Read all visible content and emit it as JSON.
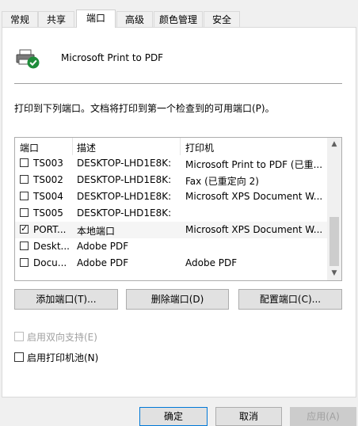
{
  "tabs": [
    {
      "label": "常规"
    },
    {
      "label": "共享"
    },
    {
      "label": "端口"
    },
    {
      "label": "高级"
    },
    {
      "label": "颜色管理"
    },
    {
      "label": "安全"
    }
  ],
  "active_tab": "端口",
  "printer_name": "Microsoft Print to PDF",
  "instruction": "打印到下列端口。文档将打印到第一个检查到的可用端口(P)。",
  "ports_list": {
    "headers": {
      "port": "端口",
      "description": "描述",
      "printer": "打印机"
    },
    "rows": [
      {
        "checked": false,
        "port": "TS003",
        "description": "DESKTOP-LHD1E8K:",
        "printer": "Microsoft Print to PDF (已重..."
      },
      {
        "checked": false,
        "port": "TS002",
        "description": "DESKTOP-LHD1E8K:",
        "printer": "Fax (已重定向 2)"
      },
      {
        "checked": false,
        "port": "TS004",
        "description": "DESKTOP-LHD1E8K:",
        "printer": "Microsoft XPS Document W..."
      },
      {
        "checked": false,
        "port": "TS005",
        "description": "DESKTOP-LHD1E8K:",
        "printer": ""
      },
      {
        "checked": true,
        "port": "PORT...",
        "description": "本地端口",
        "printer": "Microsoft XPS Document W..."
      },
      {
        "checked": false,
        "port": "Deskt...",
        "description": "Adobe PDF",
        "printer": ""
      },
      {
        "checked": false,
        "port": "Docu...",
        "description": "Adobe PDF",
        "printer": "Adobe PDF"
      }
    ]
  },
  "buttons": {
    "add_port": "添加端口(T)...",
    "delete_port": "删除端口(D)",
    "configure_port": "配置端口(C)..."
  },
  "options": {
    "bidirectional": {
      "label": "启用双向支持(E)",
      "checked": false,
      "enabled": false
    },
    "pooling": {
      "label": "启用打印机池(N)",
      "checked": false,
      "enabled": true
    }
  },
  "dialog_buttons": {
    "ok": "确定",
    "cancel": "取消",
    "apply": "应用(A)"
  },
  "icons": {
    "printer": "printer-icon",
    "default_check": "green-check-icon"
  },
  "colors": {
    "default_badge": "#1e8c3a",
    "focus_border": "#0078d7"
  }
}
